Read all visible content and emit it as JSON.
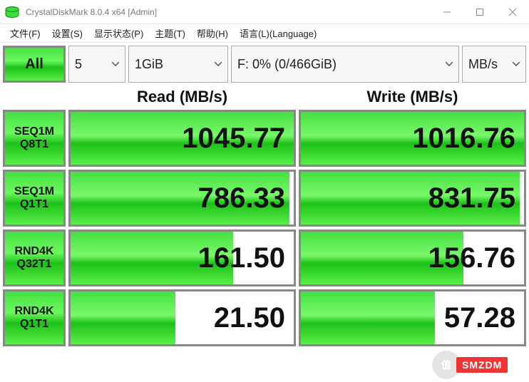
{
  "window": {
    "title": "CrystalDiskMark 8.0.4 x64 [Admin]"
  },
  "menu": {
    "file": "文件(F)",
    "settings": "设置(S)",
    "display": "显示状态(P)",
    "theme": "主题(T)",
    "help": "帮助(H)",
    "language": "语言(L)(Language)"
  },
  "controls": {
    "all_button": "All",
    "runs": "5",
    "size": "1GiB",
    "drive": "F: 0% (0/466GiB)",
    "unit": "MB/s"
  },
  "headers": {
    "read": "Read (MB/s)",
    "write": "Write (MB/s)"
  },
  "tests": [
    {
      "label1": "SEQ1M",
      "label2": "Q8T1",
      "read": "1045.77",
      "write": "1016.76",
      "read_bar": 100,
      "write_bar": 100
    },
    {
      "label1": "SEQ1M",
      "label2": "Q1T1",
      "read": "786.33",
      "write": "831.75",
      "read_bar": 98,
      "write_bar": 98
    },
    {
      "label1": "RND4K",
      "label2": "Q32T1",
      "read": "161.50",
      "write": "156.76",
      "read_bar": 73,
      "write_bar": 73
    },
    {
      "label1": "RND4K",
      "label2": "Q1T1",
      "read": "21.50",
      "write": "57.28",
      "read_bar": 47,
      "write_bar": 60
    }
  ],
  "watermark": {
    "text": "SMZDM"
  },
  "chart_data": {
    "type": "table",
    "title": "CrystalDiskMark 8.0.4 x64 — F: 0% (0/466GiB), 1GiB, 5 runs, MB/s",
    "columns": [
      "Test",
      "Read (MB/s)",
      "Write (MB/s)"
    ],
    "rows": [
      [
        "SEQ1M Q8T1",
        1045.77,
        1016.76
      ],
      [
        "SEQ1M Q1T1",
        786.33,
        831.75
      ],
      [
        "RND4K Q32T1",
        161.5,
        156.76
      ],
      [
        "RND4K Q1T1",
        21.5,
        57.28
      ]
    ]
  }
}
